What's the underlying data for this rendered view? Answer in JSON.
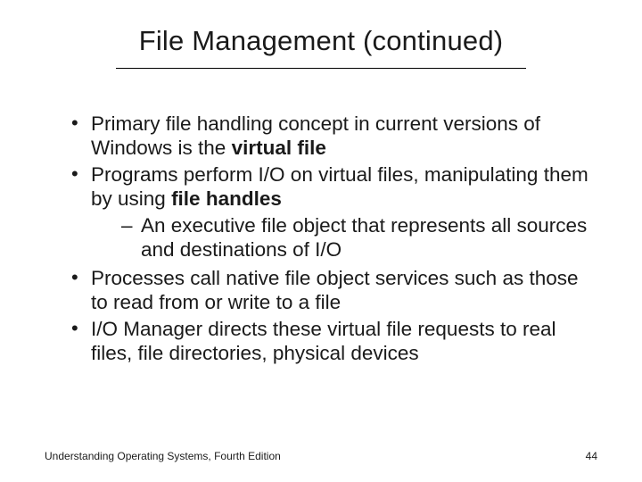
{
  "title": "File Management (continued)",
  "bullets": {
    "b1_pre": "Primary file handling concept in current versions of Windows is the ",
    "b1_bold": "virtual file",
    "b2_pre": "Programs perform I/O on virtual files, manipulating them by using ",
    "b2_bold": "file handles",
    "b2_sub": "An executive file object that represents all sources and destinations of I/O",
    "b3": "Processes call native file object services such as those to read from or write to a file",
    "b4": "I/O Manager directs these virtual file requests to real files, file directories, physical devices"
  },
  "footer": {
    "source": "Understanding Operating Systems, Fourth Edition",
    "page": "44"
  }
}
